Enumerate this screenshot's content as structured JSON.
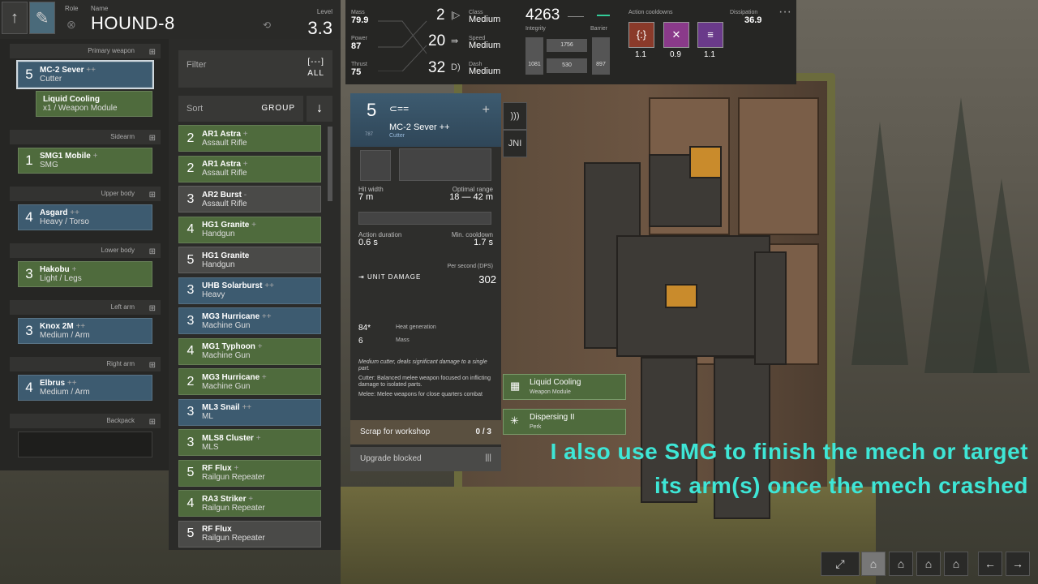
{
  "header": {
    "role_label": "Role",
    "name_label": "Name",
    "mech_name": "HOUND-8",
    "level_label": "Level",
    "level": "3.3"
  },
  "loadout": [
    {
      "section": "Primary weapon",
      "items": [
        {
          "num": "5",
          "name": "MC-2 Sever",
          "plus": "++",
          "sub": "Cutter",
          "color": "blue"
        },
        {
          "num": "",
          "name": "Liquid Cooling",
          "plus": "",
          "sub": "x1 / Weapon Module",
          "color": "green"
        }
      ]
    },
    {
      "section": "Sidearm",
      "items": [
        {
          "num": "1",
          "name": "SMG1 Mobile",
          "plus": "+",
          "sub": "SMG",
          "color": "green"
        }
      ]
    },
    {
      "section": "Upper body",
      "items": [
        {
          "num": "4",
          "name": "Asgard",
          "plus": "++",
          "sub": "Heavy / Torso",
          "color": "blue"
        }
      ]
    },
    {
      "section": "Lower body",
      "items": [
        {
          "num": "3",
          "name": "Hakobu",
          "plus": "+",
          "sub": "Light / Legs",
          "color": "green"
        }
      ]
    },
    {
      "section": "Left arm",
      "items": [
        {
          "num": "3",
          "name": "Knox 2M",
          "plus": "++",
          "sub": "Medium / Arm",
          "color": "blue"
        }
      ]
    },
    {
      "section": "Right arm",
      "items": [
        {
          "num": "4",
          "name": "Elbrus",
          "plus": "++",
          "sub": "Medium / Arm",
          "color": "blue"
        }
      ]
    },
    {
      "section": "Backpack",
      "items": []
    }
  ],
  "filter": {
    "label": "Filter",
    "value": "ALL",
    "icon": "[---]"
  },
  "sort": {
    "label": "Sort",
    "value": "GROUP",
    "dir": "↓"
  },
  "weapons": [
    {
      "num": "2",
      "name": "AR1 Astra",
      "plus": "+",
      "sub": "Assault Rifle",
      "color": "green"
    },
    {
      "num": "2",
      "name": "AR1 Astra",
      "plus": "+",
      "sub": "Assault Rifle",
      "color": "green"
    },
    {
      "num": "3",
      "name": "AR2 Burst",
      "plus": "-",
      "sub": "Assault Rifle",
      "color": "grey"
    },
    {
      "num": "4",
      "name": "HG1 Granite",
      "plus": "+",
      "sub": "Handgun",
      "color": "green"
    },
    {
      "num": "5",
      "name": "HG1 Granite",
      "plus": "",
      "sub": "Handgun",
      "color": "grey"
    },
    {
      "num": "3",
      "name": "UHB Solarburst",
      "plus": "++",
      "sub": "Heavy",
      "color": "blue"
    },
    {
      "num": "3",
      "name": "MG3 Hurricane",
      "plus": "++",
      "sub": "Machine Gun",
      "color": "blue"
    },
    {
      "num": "4",
      "name": "MG1 Typhoon",
      "plus": "+",
      "sub": "Machine Gun",
      "color": "green"
    },
    {
      "num": "2",
      "name": "MG3 Hurricane",
      "plus": "+",
      "sub": "Machine Gun",
      "color": "green"
    },
    {
      "num": "3",
      "name": "ML3 Snail",
      "plus": "++",
      "sub": "ML",
      "color": "blue"
    },
    {
      "num": "3",
      "name": "MLS8 Cluster",
      "plus": "+",
      "sub": "MLS",
      "color": "green"
    },
    {
      "num": "5",
      "name": "RF Flux",
      "plus": "+",
      "sub": "Railgun Repeater",
      "color": "green"
    },
    {
      "num": "4",
      "name": "RA3 Striker",
      "plus": "+",
      "sub": "Railgun Repeater",
      "color": "green"
    },
    {
      "num": "5",
      "name": "RF Flux",
      "plus": "",
      "sub": "Railgun Repeater",
      "color": "grey"
    }
  ],
  "detail": {
    "level": "5",
    "name": "MC-2 Sever ++",
    "class": "Cutter",
    "small_num": "787",
    "hit_width_label": "Hit width",
    "hit_width": "7 m",
    "opt_range_label": "Optimal range",
    "opt_range": "18 — 42 m",
    "action_dur_label": "Action duration",
    "action_dur": "0.6 s",
    "min_cd_label": "Min. cooldown",
    "min_cd": "1.7 s",
    "dps_label": "Per second (DPS)",
    "dmg_label": "UNIT DAMAGE",
    "dps": "302",
    "heat_val": "84*",
    "heat_label": "Heat generation",
    "mass_val": "6",
    "mass_label": "Mass",
    "desc1": "Medium cutter, deals significant damage to a single part.",
    "desc2": "Cutter: Balanced melee weapon focused on inflicting damage to isolated parts.",
    "desc3": "Melee: Melee weapons for close quarters combat",
    "scrap_label": "Scrap for workshop",
    "scrap_count": "0 / 3",
    "upgrade_label": "Upgrade blocked"
  },
  "stats": {
    "mass_label": "Mass",
    "mass": "79.9",
    "power_label": "Power",
    "power": "87",
    "thrust_label": "Thrust",
    "thrust": "75",
    "class_num": "2",
    "class_label": "Class",
    "class_val": "Medium",
    "speed_num": "20",
    "speed_label": "Speed",
    "speed_val": "Medium",
    "dash_num": "32",
    "dash_label": "Dash",
    "dash_val": "Medium",
    "integrity_total": "4263",
    "integrity_label": "Integrity",
    "barrier_label": "Barrier",
    "i1": "1756",
    "i2": "1081",
    "i3": "530",
    "i4": "897",
    "cooldowns_label": "Action cooldowns",
    "cd": [
      "1.1",
      "0.9",
      "1.1"
    ],
    "dissipation_label": "Dissipation",
    "dissipation": "36.9",
    "colors": {
      "cd1": "#8a3a2a",
      "cd2": "#8a3a8a",
      "cd3": "#6a3a8a"
    }
  },
  "mods": [
    {
      "name": "Liquid Cooling",
      "sub": "Weapon Module"
    },
    {
      "name": "Dispersing II",
      "sub": "Perk"
    }
  ],
  "caption": {
    "line1": "I also use SMG to finish the mech or target",
    "line2": "its arm(s) once the mech crashed"
  }
}
